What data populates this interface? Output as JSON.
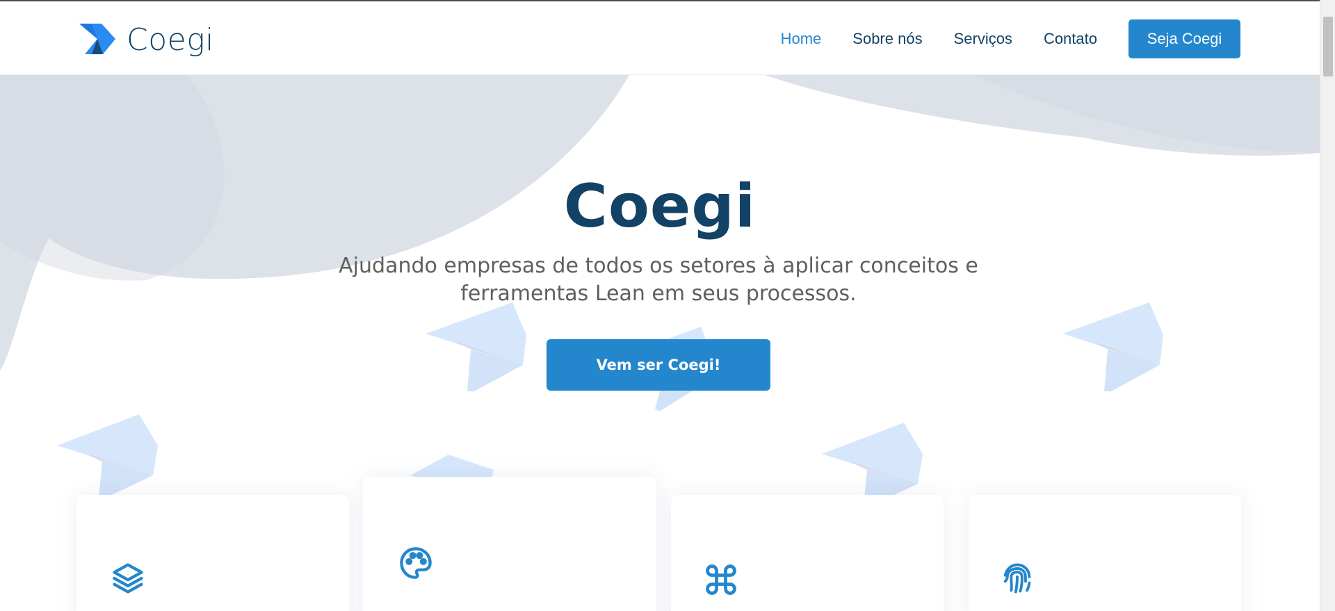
{
  "brand": {
    "name": "Coegi",
    "logo_icon": "chevron-logo-icon"
  },
  "nav": {
    "items": [
      {
        "label": "Home",
        "active": true
      },
      {
        "label": "Sobre nós",
        "active": false
      },
      {
        "label": "Serviços",
        "active": false
      },
      {
        "label": "Contato",
        "active": false
      }
    ],
    "cta_label": "Seja Coegi"
  },
  "hero": {
    "title": "Coegi",
    "subtitle": "Ajudando empresas de todos os setores à aplicar conceitos e ferramentas Lean em seus processos.",
    "button_label": "Vem ser Coegi!"
  },
  "cards": [
    {
      "icon": "layers-icon"
    },
    {
      "icon": "palette-icon"
    },
    {
      "icon": "command-icon"
    },
    {
      "icon": "fingerprint-icon"
    }
  ],
  "colors": {
    "primary": "#2487ce",
    "heading": "#124265",
    "text": "#5f5f5f",
    "hero_shape": "#dde1e8",
    "decor_arrow": "#d4e6fb"
  }
}
